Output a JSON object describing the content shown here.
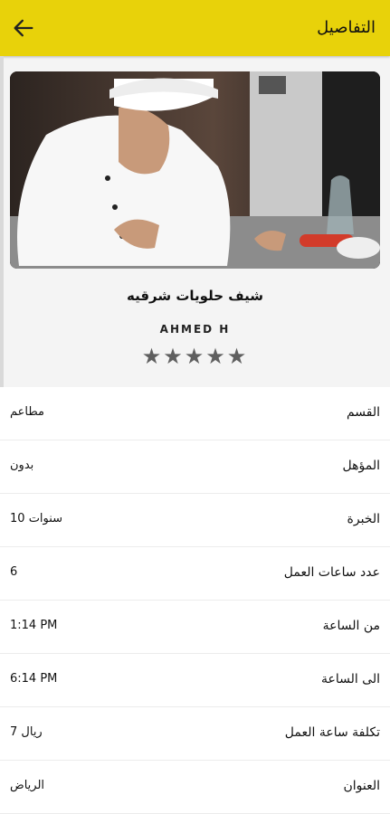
{
  "appbar": {
    "title": "التفاصيل",
    "back_icon": "arrow-left-icon"
  },
  "profile": {
    "title": "شيف حلويات شرقيه",
    "name": "AHMED H",
    "rating": 5,
    "rating_max": 5,
    "stars": "★★★★★"
  },
  "details": [
    {
      "label": "القسم",
      "value": "مطاعم"
    },
    {
      "label": "المؤهل",
      "value": "بدون"
    },
    {
      "label": "الخبرة",
      "value": "10 سنوات"
    },
    {
      "label": "عدد ساعات العمل",
      "value": "6"
    },
    {
      "label": "من الساعة",
      "value": "1:14 PM"
    },
    {
      "label": "الى الساعة",
      "value": "6:14 PM"
    },
    {
      "label": "تكلفة ساعة العمل",
      "value": "7 ريال"
    },
    {
      "label": "العنوان",
      "value": "الرياض"
    }
  ],
  "colors": {
    "accent": "#e8d20a",
    "star": "#5f5f5f"
  }
}
